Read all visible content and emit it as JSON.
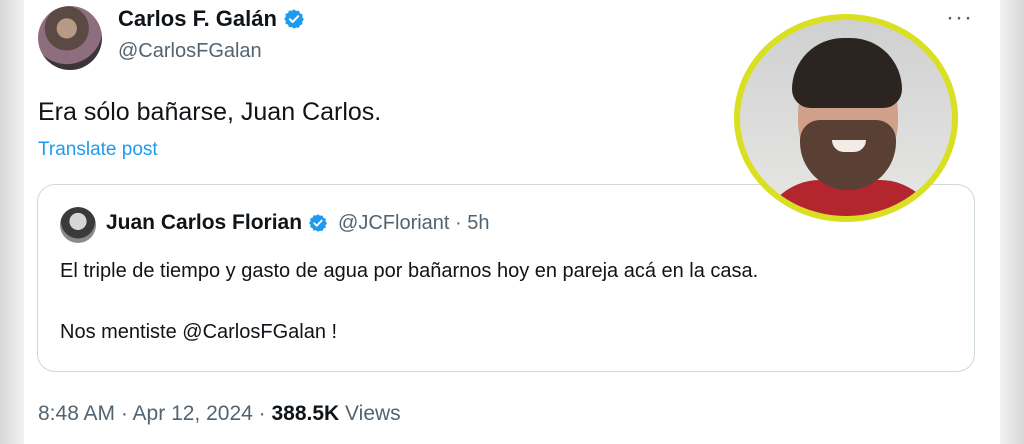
{
  "tweet": {
    "author": {
      "display_name": "Carlos F. Galán",
      "handle": "@CarlosFGalan"
    },
    "text": "Era sólo bañarse, Juan Carlos.",
    "translate_label": "Translate post",
    "more_label": "···",
    "quote": {
      "display_name": "Juan Carlos Florian",
      "handle_time": "@JCFloriant · 5h",
      "text_line1": "El triple de tiempo y gasto de agua por bañarnos hoy en pareja acá en la casa.",
      "text_line2": "Nos mentiste @CarlosFGalan !"
    },
    "footer": {
      "timestamp": "8:48 AM · Apr 12, 2024 · ",
      "views_count": "388.5K",
      "views_label": " Views"
    }
  },
  "colors": {
    "accent": "#1d9bf0",
    "secondary_text": "#536471",
    "highlight_ring": "#d9e021"
  },
  "icons": {
    "verified": "verified-badge-icon",
    "more": "more-horizontal-icon"
  }
}
